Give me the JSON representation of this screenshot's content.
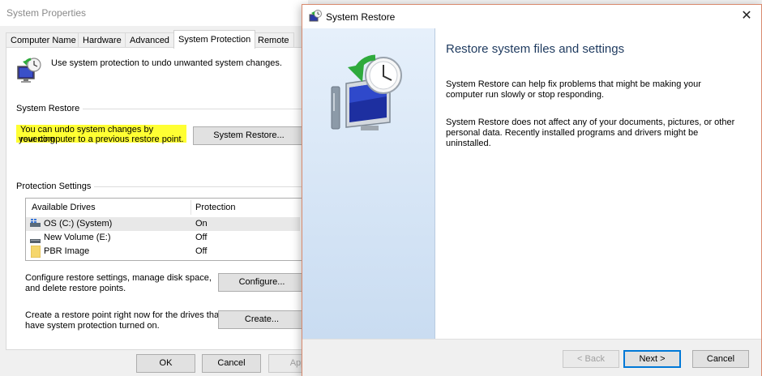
{
  "sys_props": {
    "title": "System Properties",
    "tabs": [
      "Computer Name",
      "Hardware",
      "Advanced",
      "System Protection",
      "Remote"
    ],
    "intro_text": "Use system protection to undo unwanted system changes.",
    "system_restore": {
      "group_label": "System Restore",
      "line1": "You can undo system changes by reverting",
      "line2": "your computer to a previous restore point.",
      "button": "System Restore..."
    },
    "protection": {
      "group_label": "Protection Settings",
      "col_drives": "Available Drives",
      "col_protection": "Protection",
      "rows": [
        {
          "drive": "OS (C:) (System)",
          "protection": "On"
        },
        {
          "drive": "New Volume (E:)",
          "protection": "Off"
        },
        {
          "drive": "PBR Image",
          "protection": "Off"
        }
      ]
    },
    "configure": {
      "line1": "Configure restore settings, manage disk space,",
      "line2": "and delete restore points.",
      "button": "Configure..."
    },
    "create": {
      "line1": "Create a restore point right now for the drives that",
      "line2": "have system protection turned on.",
      "button": "Create..."
    },
    "footer": {
      "ok": "OK",
      "cancel": "Cancel",
      "apply": "App"
    }
  },
  "restore_dialog": {
    "title": "System Restore",
    "heading": "Restore system files and settings",
    "para1": "System Restore can help fix problems that might be making your computer run slowly or stop responding.",
    "para2": "System Restore does not affect any of your documents, pictures, or other personal data. Recently installed programs and drivers might be uninstalled.",
    "close_glyph": "✕",
    "buttons": {
      "back": "< Back",
      "next": "Next >",
      "cancel": "Cancel"
    }
  },
  "colors": {
    "highlight": "#ffff33",
    "accent": "#0078d7",
    "dialog_border": "#d98a6e",
    "heading": "#1e3a5f"
  }
}
